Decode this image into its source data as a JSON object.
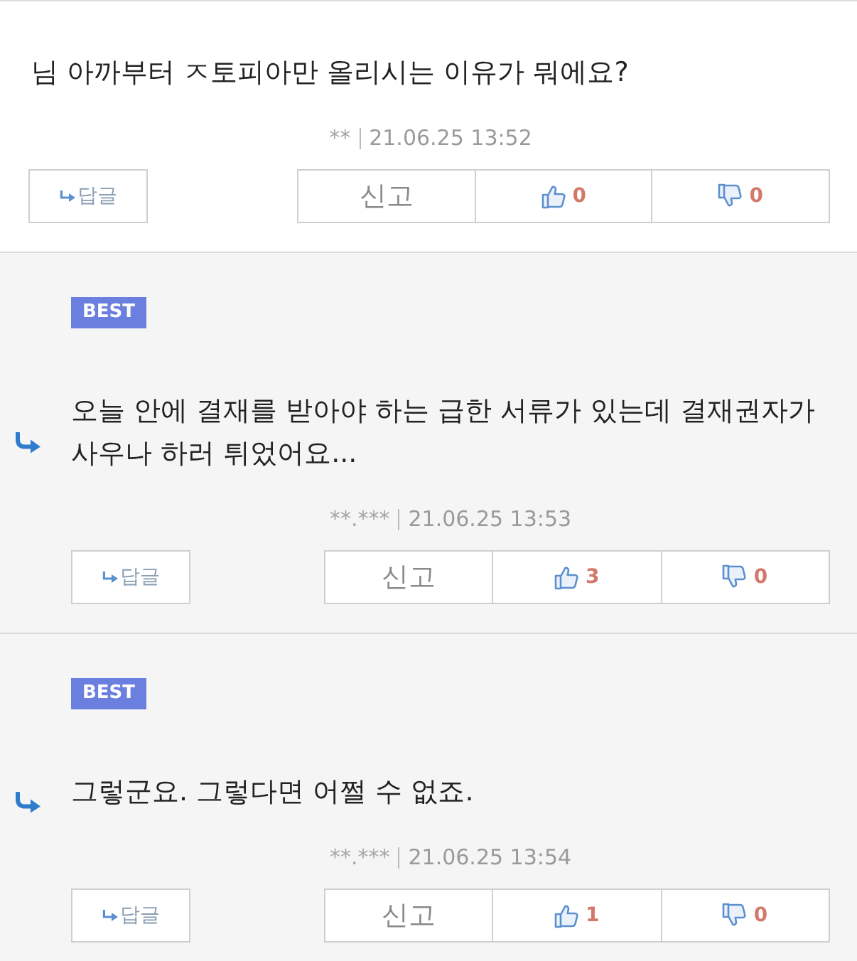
{
  "comments": [
    {
      "is_reply": false,
      "text": "님 아까부터 ㅈ토피아만 올리시는 이유가 뭐에요?",
      "author": "**",
      "date": "21.06.25 13:52",
      "reply_label": "답글",
      "report_label": "신고",
      "likes": "0",
      "dislikes": "0"
    },
    {
      "is_reply": true,
      "badge": "BEST",
      "text": "오늘 안에 결재를 받아야 하는 급한 서류가 있는데 결재권자가 사우나 하러 튀었어요...",
      "author": "**.***",
      "date": "21.06.25 13:53",
      "reply_label": "답글",
      "report_label": "신고",
      "likes": "3",
      "dislikes": "0"
    },
    {
      "is_reply": true,
      "badge": "BEST",
      "text": "그렇군요. 그렇다면 어쩔 수 없죠.",
      "author": "**.***",
      "date": "21.06.25 13:54",
      "reply_label": "답글",
      "report_label": "신고",
      "likes": "1",
      "dislikes": "0"
    }
  ]
}
